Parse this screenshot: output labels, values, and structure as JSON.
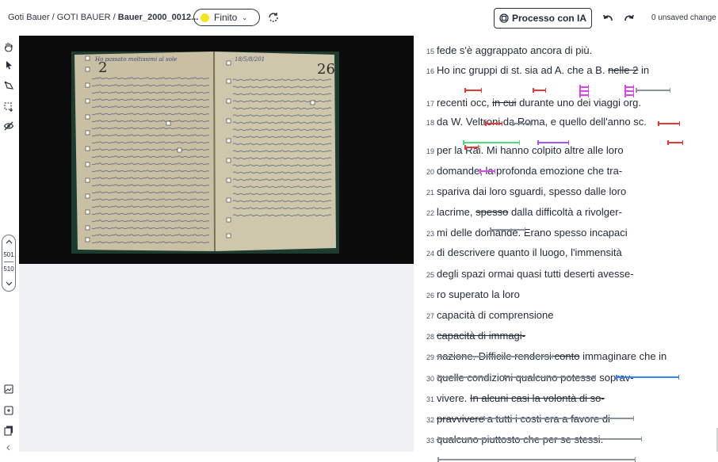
{
  "breadcrumb": {
    "part1": "Goti Bauer",
    "sep": " / ",
    "part2": "GOTI BAUER",
    "current": "Bauer_2000_0012..."
  },
  "status": {
    "label": "Finito",
    "color": "#f7e51c"
  },
  "ai_button": {
    "label": "Processo con IA"
  },
  "unsaved": "0 unsaved change",
  "pager": {
    "current": "501",
    "total": "510"
  },
  "colors": {
    "red": "#e53935",
    "magenta": "#d946ef",
    "green": "#4ade80",
    "purple": "#a855f7",
    "gray": "#8a939e",
    "blue": "#3b82f6"
  },
  "lines": [
    {
      "n": "15",
      "segs": [
        "fede s'è aggrappato ancora di più."
      ]
    },
    {
      "n": "16",
      "segs": [
        "Ho inc gruppi di st. sia ad A. che a B. ",
        "nelle 2",
        " in"
      ]
    },
    {
      "n": "17",
      "segs": [
        "recenti occ, ",
        "in cui",
        " durante uno dei viaggi org."
      ]
    },
    {
      "n": "18",
      "segs": [
        "da W. Veltroni da Roma, e quello dell'anno sc."
      ]
    },
    {
      "n": "19",
      "segs": [
        "per la Rai. Mi hanno colpito altre alle loro"
      ]
    },
    {
      "n": "20",
      "segs": [
        "domande, la profonda emozione che tra-"
      ]
    },
    {
      "n": "21",
      "segs": [
        "spariva dai loro sguardi, spesso dalle loro"
      ]
    },
    {
      "n": "22",
      "segs": [
        "lacrime, ",
        "spesso",
        " dalla difficoltà a rivolger-"
      ]
    },
    {
      "n": "23",
      "segs": [
        "mi delle domande. Erano spesso incapaci"
      ]
    },
    {
      "n": "24",
      "segs": [
        "di descrivere quanto il luogo, l'immensità"
      ]
    },
    {
      "n": "25",
      "segs": [
        "degli spazi ormai quasi tutti deserti avesse-"
      ]
    },
    {
      "n": "26",
      "segs": [
        "ro superato la loro"
      ]
    },
    {
      "n": "27",
      "segs": [
        "capacità di comprensione"
      ]
    },
    {
      "n": "28",
      "segs": [
        "",
        "capacità di immagi-"
      ]
    },
    {
      "n": "29",
      "segs": [
        "",
        "nazione",
        ". Difficile ",
        "rendersi conto",
        " immaginare che in"
      ]
    },
    {
      "n": "30",
      "segs": [
        "quelle condizioni qualcuno potesse soprav-"
      ]
    },
    {
      "n": "31",
      "segs": [
        "vivere. ",
        "In alcuni casi la volontà di so-"
      ]
    },
    {
      "n": "32",
      "segs": [
        "",
        "pravvivere a tutti i costi era a favore di"
      ]
    },
    {
      "n": "33",
      "segs": [
        "",
        "qualcuno piuttosto che per se stessi."
      ]
    }
  ],
  "notebook": {
    "left_page_number": "2",
    "right_page_number": "26",
    "left_heading": "Ho passato moltissimi al sole",
    "right_heading": "18/5/8/201"
  }
}
